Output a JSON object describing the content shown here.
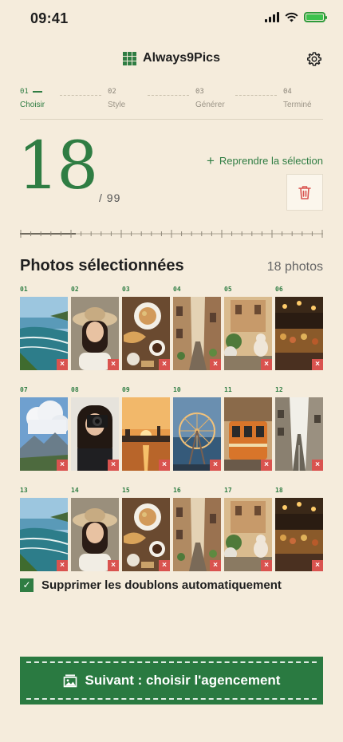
{
  "status_bar": {
    "time": "09:41"
  },
  "header": {
    "app_name": "Always9Pics"
  },
  "stepper": {
    "steps": [
      {
        "num": "01",
        "label": "Choisir",
        "active": true
      },
      {
        "num": "02",
        "label": "Style",
        "active": false
      },
      {
        "num": "03",
        "label": "Générer",
        "active": false
      },
      {
        "num": "04",
        "label": "Terminé",
        "active": false
      }
    ]
  },
  "counter": {
    "selected": "18",
    "total": "/ 99",
    "resume_label": "Reprendre la sélection"
  },
  "section": {
    "title": "Photos sélectionnées",
    "count": "18 photos"
  },
  "photos": [
    {
      "num": "01",
      "subject": "coastline"
    },
    {
      "num": "02",
      "subject": "woman-straw-hat"
    },
    {
      "num": "03",
      "subject": "breakfast-table"
    },
    {
      "num": "04",
      "subject": "narrow-alley"
    },
    {
      "num": "05",
      "subject": "garden-cat"
    },
    {
      "num": "06",
      "subject": "night-market"
    },
    {
      "num": "07",
      "subject": "clouds-mountains"
    },
    {
      "num": "08",
      "subject": "woman-camera"
    },
    {
      "num": "09",
      "subject": "sunset-city"
    },
    {
      "num": "10",
      "subject": "ferris-wheel"
    },
    {
      "num": "11",
      "subject": "tram"
    },
    {
      "num": "12",
      "subject": "empty-street"
    },
    {
      "num": "13",
      "subject": "coastline"
    },
    {
      "num": "14",
      "subject": "woman-straw-hat"
    },
    {
      "num": "15",
      "subject": "breakfast-table"
    },
    {
      "num": "16",
      "subject": "narrow-alley"
    },
    {
      "num": "17",
      "subject": "garden-cat"
    },
    {
      "num": "18",
      "subject": "night-market"
    }
  ],
  "remove_symbol": "×",
  "dedupe": {
    "label": "Supprimer les doublons automatiquement",
    "checked": true,
    "check_symbol": "✓"
  },
  "next_button": {
    "label": "Suivant : choisir l'agencement"
  },
  "colors": {
    "accent": "#2f7d43",
    "background": "#f5ecdc",
    "danger": "#d9534f",
    "button": "#2a7a41"
  }
}
